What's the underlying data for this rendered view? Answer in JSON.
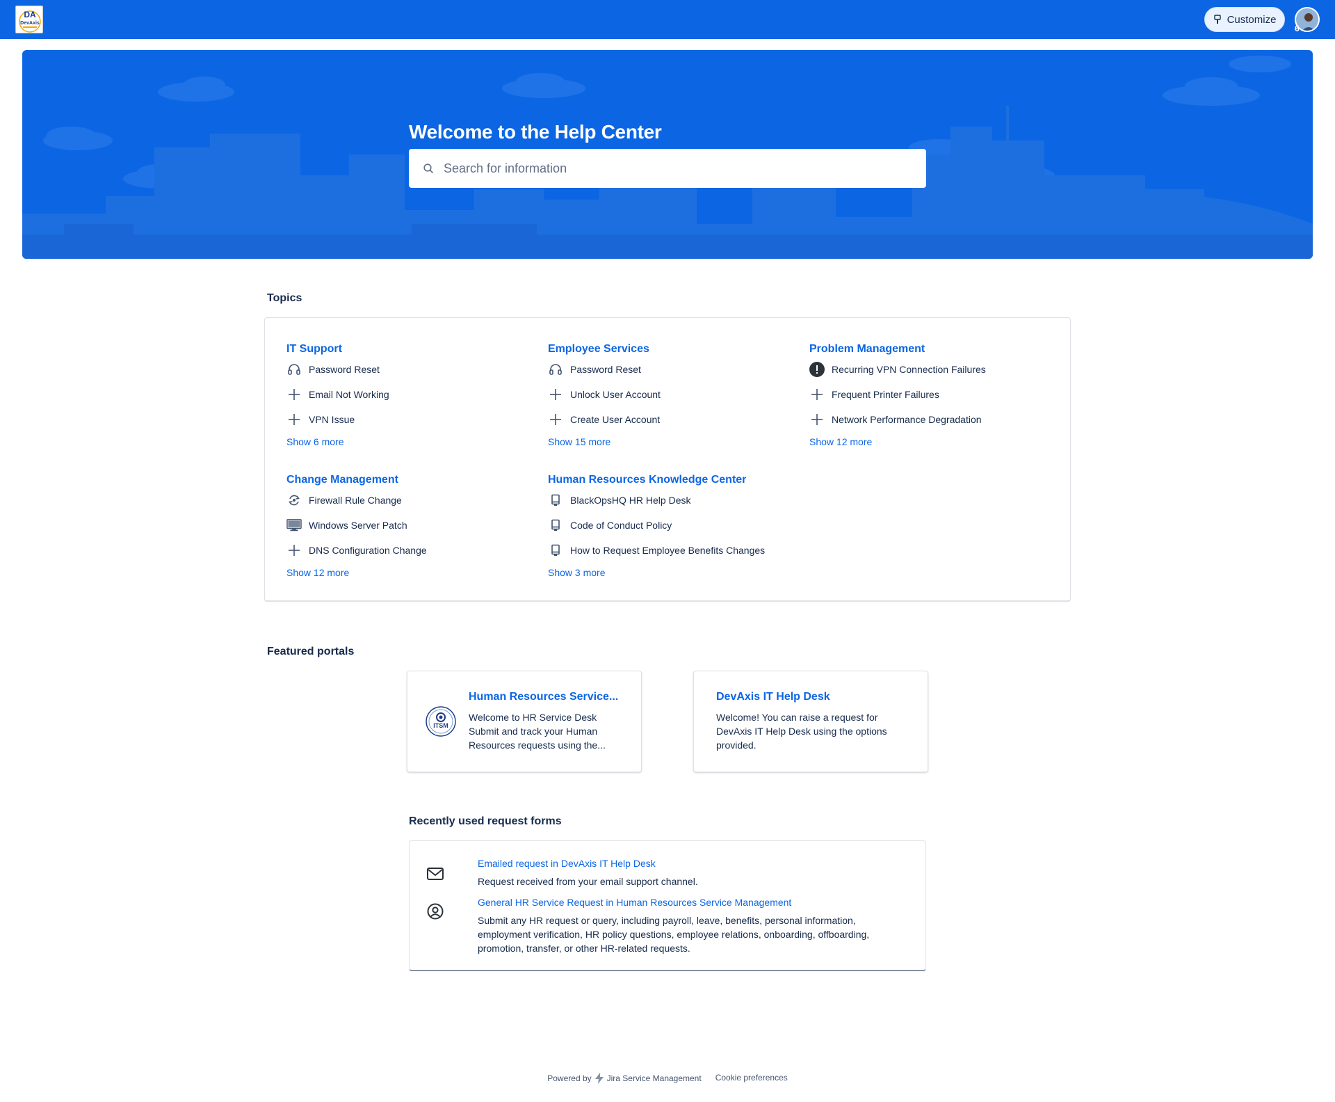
{
  "nav": {
    "logo_label": "DevAxis",
    "customize_label": "Customize",
    "avatar_badge": "6"
  },
  "hero": {
    "title": "Welcome to the Help Center",
    "search_placeholder": "Search for information"
  },
  "topics": {
    "heading": "Topics",
    "groups": [
      {
        "title": "IT Support",
        "items": [
          {
            "label": "Password Reset",
            "icon": "headset-icon"
          },
          {
            "label": "Email Not Working",
            "icon": "plus-icon"
          },
          {
            "label": "VPN Issue",
            "icon": "plus-icon"
          }
        ],
        "more": "Show 6 more"
      },
      {
        "title": "Employee Services",
        "items": [
          {
            "label": "Password Reset",
            "icon": "headset-icon"
          },
          {
            "label": "Unlock User Account",
            "icon": "plus-icon"
          },
          {
            "label": "Create User Account",
            "icon": "plus-icon"
          }
        ],
        "more": "Show 15 more"
      },
      {
        "title": "Problem Management",
        "items": [
          {
            "label": "Recurring VPN Connection Failures",
            "icon": "alert-icon"
          },
          {
            "label": "Frequent Printer Failures",
            "icon": "plus-icon"
          },
          {
            "label": "Network Performance Degradation",
            "icon": "plus-icon"
          }
        ],
        "more": "Show 12 more"
      },
      {
        "title": "Change Management",
        "items": [
          {
            "label": "Firewall Rule Change",
            "icon": "refresh-gear-icon"
          },
          {
            "label": "Windows Server Patch",
            "icon": "monitor-icon"
          },
          {
            "label": "DNS Configuration Change",
            "icon": "plus-icon"
          }
        ],
        "more": "Show 12 more"
      },
      {
        "title": "Human Resources Knowledge Center",
        "items": [
          {
            "label": "BlackOpsHQ HR Help Desk",
            "icon": "book-icon"
          },
          {
            "label": "Code of Conduct Policy",
            "icon": "book-icon"
          },
          {
            "label": "How to Request Employee Benefits Changes",
            "icon": "book-icon"
          }
        ],
        "more": "Show 3 more"
      }
    ]
  },
  "featured": {
    "heading": "Featured portals",
    "portals": [
      {
        "title": "Human Resources Service...",
        "description": "Welcome to HR Service Desk Submit and track your Human Resources requests using the...",
        "logo_text": "ITSM"
      },
      {
        "title": "DevAxis IT Help Desk",
        "description": "Welcome! You can raise a request for DevAxis IT Help Desk using the options provided."
      }
    ]
  },
  "recent": {
    "heading": "Recently used request forms",
    "items": [
      {
        "title": "Emailed request in DevAxis IT Help Desk",
        "description": "Request received from your email support channel.",
        "icon": "envelope-icon"
      },
      {
        "title": "General HR Service Request in Human Resources Service Management",
        "description": "Submit any HR request or query, including payroll, leave, benefits, personal information, employment verification, HR policy questions, employee relations, onboarding, offboarding, promotion, transfer, or other HR-related requests.",
        "icon": "person-circle-icon"
      }
    ]
  },
  "footer": {
    "powered_by": "Powered by",
    "product": "Jira Service Management",
    "cookie": "Cookie preferences"
  },
  "colors": {
    "brand": "#0c66e4",
    "text": "#172b4d",
    "link": "#0c66e4"
  }
}
